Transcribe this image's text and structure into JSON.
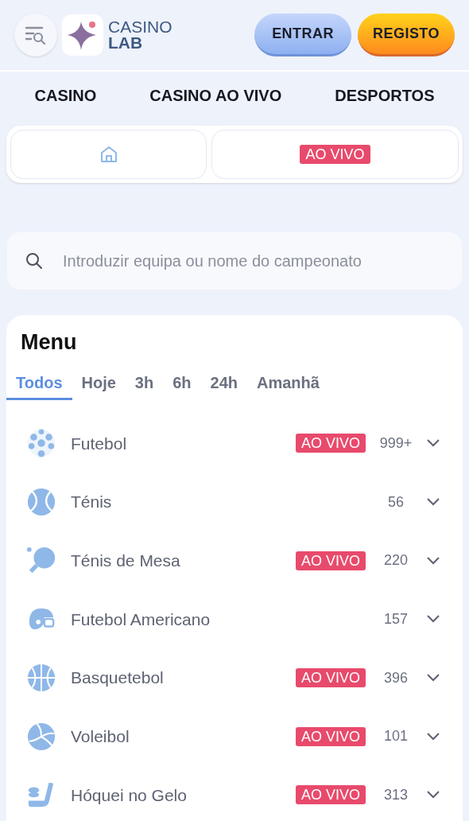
{
  "header": {
    "logo": {
      "line1": "CASINO",
      "line2": "LAB"
    },
    "buttons": [
      {
        "label": "ENTRAR",
        "kind": "login"
      },
      {
        "label": "REGISTO",
        "kind": "register"
      }
    ]
  },
  "nav": [
    "CASINO",
    "CASINO AO VIVO",
    "DESPORTOS"
  ],
  "quick_tabs": [
    {
      "kind": "home"
    },
    {
      "kind": "live",
      "label": "AO VIVO"
    }
  ],
  "search": {
    "placeholder": "Introduzir equipa ou nome do campeonato"
  },
  "menu": {
    "title": "Menu",
    "filters": [
      {
        "label": "Todos",
        "selected": true
      },
      {
        "label": "Hoje",
        "selected": false
      },
      {
        "label": "3h",
        "selected": false
      },
      {
        "label": "6h",
        "selected": false
      },
      {
        "label": "24h",
        "selected": false
      },
      {
        "label": "Amanhã",
        "selected": false
      }
    ],
    "sports": [
      {
        "name": "Futebol",
        "kind": "soccer",
        "live": "AO VIVO",
        "count": "999+"
      },
      {
        "name": "Ténis",
        "kind": "tennis",
        "count": "56"
      },
      {
        "name": "Ténis de Mesa",
        "kind": "pingpong",
        "live": "AO VIVO",
        "count": "220"
      },
      {
        "name": "Futebol Americano",
        "kind": "football",
        "count": "157"
      },
      {
        "name": "Basquetebol",
        "kind": "basketball",
        "live": "AO VIVO",
        "count": "396"
      },
      {
        "name": "Voleibol",
        "kind": "volleyball",
        "live": "AO VIVO",
        "count": "101"
      },
      {
        "name": "Hóquei no Gelo",
        "kind": "hockey",
        "live": "AO VIVO",
        "count": "313"
      }
    ]
  }
}
